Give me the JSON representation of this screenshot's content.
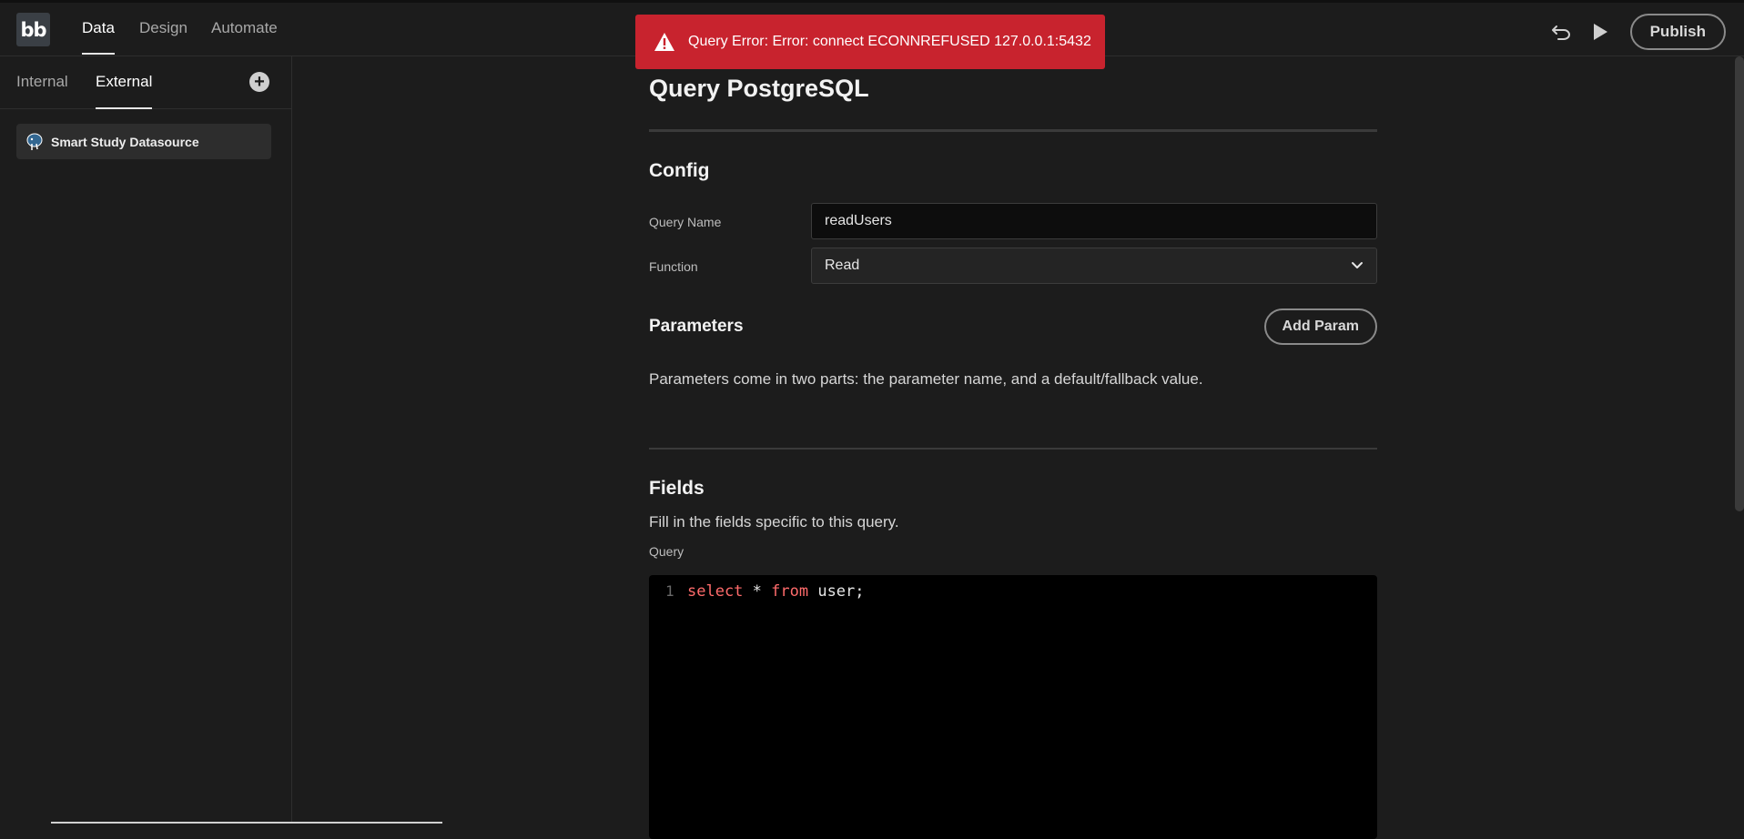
{
  "header": {
    "logo": "bb",
    "tabs": [
      {
        "label": "Data",
        "active": true
      },
      {
        "label": "Design",
        "active": false
      },
      {
        "label": "Automate",
        "active": false
      }
    ],
    "actions": {
      "undo_icon": "undo-icon",
      "preview_icon": "play-icon",
      "publish_label": "Publish"
    }
  },
  "toast": {
    "message": "Query Error: Error: connect ECONNREFUSED 127.0.0.1:5432",
    "icon": "alert-triangle-icon",
    "color": "#c8232e"
  },
  "sidebar": {
    "tabs": [
      {
        "label": "Internal",
        "active": false
      },
      {
        "label": "External",
        "active": true
      }
    ],
    "add_icon": "add-circle-icon",
    "datasources": [
      {
        "label": "Smart Study Datasource",
        "icon": "postgresql-icon"
      }
    ]
  },
  "main": {
    "title": "Query PostgreSQL",
    "config": {
      "heading": "Config",
      "query_name_label": "Query Name",
      "query_name_value": "readUsers",
      "function_label": "Function",
      "function_value": "Read"
    },
    "parameters": {
      "heading": "Parameters",
      "add_label": "Add Param",
      "description": "Parameters come in two parts: the parameter name, and a default/fallback value."
    },
    "fields": {
      "heading": "Fields",
      "description": "Fill in the fields specific to this query.",
      "query_label": "Query",
      "line_number": "1",
      "code": {
        "kw1": "select",
        "mid": " * ",
        "kw2": "from",
        "rest": " user;"
      }
    }
  }
}
